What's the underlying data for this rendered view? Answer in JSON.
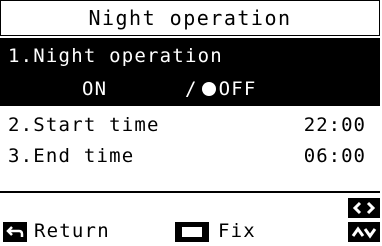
{
  "screen": {
    "title": "Night operation"
  },
  "items": [
    {
      "label": "1.Night operation"
    },
    {
      "label": "2.Start time",
      "value": "22:00"
    },
    {
      "label": "3.End time",
      "value": "06:00"
    }
  ],
  "night_operation": {
    "on_label": "ON",
    "separator": "/",
    "off_label": "OFF",
    "selected": "OFF"
  },
  "footer": {
    "return_label": "Return",
    "fix_label": "Fix"
  },
  "icons": {
    "return": "return-arrow-icon",
    "fix": "fix-square-icon",
    "left_right": "left-right-arrows-icon",
    "up_down": "up-down-arrows-icon"
  }
}
